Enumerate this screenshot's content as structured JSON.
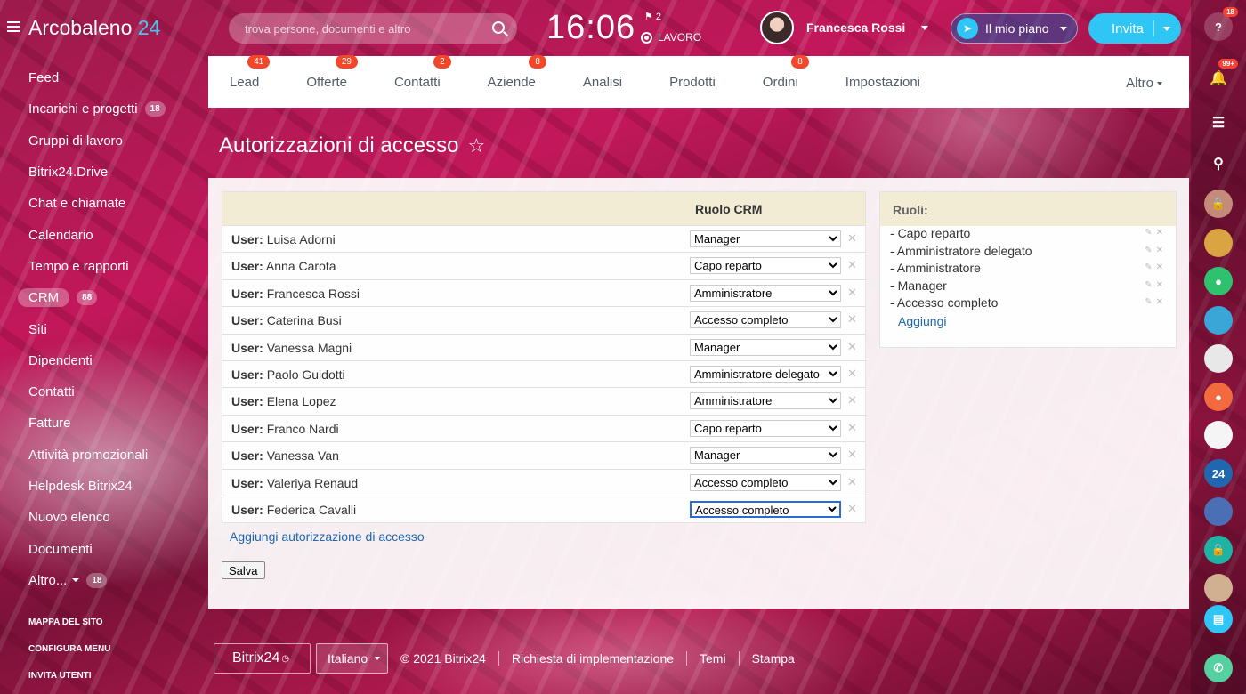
{
  "header": {
    "logo_name": "Arcobaleno",
    "logo_num": "24",
    "search_placeholder": "trova persone, documenti e altro",
    "clock": "16:06",
    "flag_count": "2",
    "work_status": "LAVORO",
    "user_name": "Francesca Rossi",
    "plan_label": "Il mio piano",
    "invite_label": "Invita"
  },
  "sidebar": {
    "items": [
      {
        "label": "Feed",
        "count": ""
      },
      {
        "label": "Incarichi e progetti",
        "count": "18"
      },
      {
        "label": "Gruppi di lavoro",
        "count": ""
      },
      {
        "label": "Bitrix24.Drive",
        "count": ""
      },
      {
        "label": "Chat e chiamate",
        "count": ""
      },
      {
        "label": "Calendario",
        "count": ""
      },
      {
        "label": "Tempo e rapporti",
        "count": ""
      },
      {
        "label": "CRM",
        "count": "88"
      },
      {
        "label": "Siti",
        "count": ""
      },
      {
        "label": "Dipendenti",
        "count": ""
      },
      {
        "label": "Contatti",
        "count": ""
      },
      {
        "label": "Fatture",
        "count": ""
      },
      {
        "label": "Attività promozionali",
        "count": ""
      },
      {
        "label": "Helpdesk Bitrix24",
        "count": ""
      },
      {
        "label": "Nuovo elenco",
        "count": ""
      },
      {
        "label": "Documenti",
        "count": ""
      },
      {
        "label": "Altro...",
        "count": "18"
      }
    ],
    "links": [
      "MAPPA DEL SITO",
      "CONFIGURA MENU",
      "INVITA UTENTI"
    ]
  },
  "rightbar": {
    "help_badge": "18",
    "notif_badge": "99+",
    "chat_label": "24"
  },
  "tabs": [
    {
      "label": "Lead",
      "badge": "41"
    },
    {
      "label": "Offerte",
      "badge": "29"
    },
    {
      "label": "Contatti",
      "badge": "2"
    },
    {
      "label": "Aziende",
      "badge": "8"
    },
    {
      "label": "Analisi",
      "badge": ""
    },
    {
      "label": "Prodotti",
      "badge": ""
    },
    {
      "label": "Ordini",
      "badge": "8"
    },
    {
      "label": "Impostazioni",
      "badge": ""
    }
  ],
  "tabs_more": "Altro",
  "page_title": "Autorizzazioni di accesso",
  "permissions": {
    "column_header": "Ruolo CRM",
    "user_prefix": "User:",
    "rows": [
      {
        "user": "Luisa Adorni",
        "role": "Manager"
      },
      {
        "user": "Anna Carota",
        "role": "Capo reparto"
      },
      {
        "user": "Francesca Rossi",
        "role": "Amministratore"
      },
      {
        "user": "Caterina Busi",
        "role": "Accesso completo"
      },
      {
        "user": "Vanessa Magni",
        "role": "Manager"
      },
      {
        "user": "Paolo Guidotti",
        "role": "Amministratore delegato"
      },
      {
        "user": "Elena Lopez",
        "role": "Amministratore"
      },
      {
        "user": "Franco Nardi",
        "role": "Capo reparto"
      },
      {
        "user": "Vanessa Van",
        "role": "Manager"
      },
      {
        "user": "Valeriya Renaud",
        "role": "Accesso completo"
      },
      {
        "user": "Federica Cavalli",
        "role": "Accesso completo"
      }
    ],
    "add_link": "Aggiungi autorizzazione di accesso",
    "save_label": "Salva"
  },
  "roles": {
    "header": "Ruoli:",
    "items": [
      "Capo reparto",
      "Amministratore delegato",
      "Amministratore",
      "Manager",
      "Accesso completo"
    ],
    "add_label": "Aggiungi"
  },
  "footer": {
    "brand": "Bitrix24",
    "language": "Italiano",
    "copyright": "© 2021 Bitrix24",
    "links": [
      "Richiesta di implementazione",
      "Temi",
      "Stampa"
    ]
  }
}
